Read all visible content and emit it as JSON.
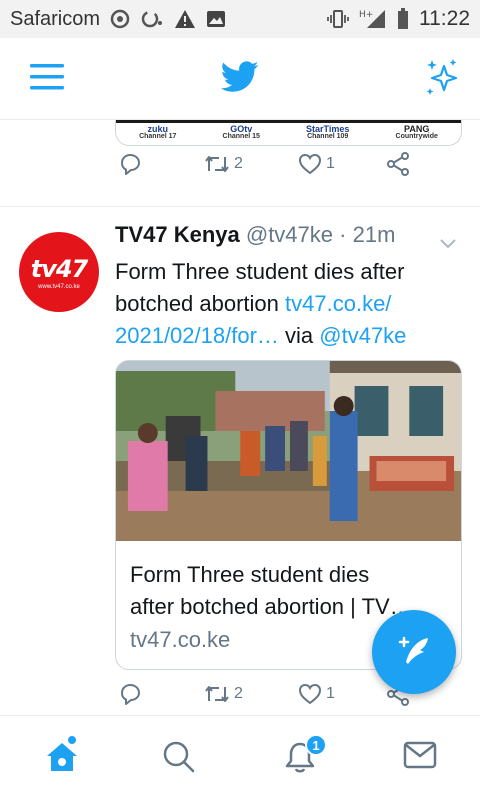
{
  "status_bar": {
    "carrier": "Safaricom",
    "network": "H+",
    "time": "11:22"
  },
  "top_nav": {
    "icons": [
      "menu-icon",
      "twitter-bird-icon",
      "sparkle-icon"
    ]
  },
  "previous_tweet": {
    "channels": [
      {
        "logo": "zuku",
        "label": "Channel 17"
      },
      {
        "logo": "GOtv",
        "label": "Channel 15"
      },
      {
        "logo": "StarTimes",
        "label": "Channel 109"
      },
      {
        "logo": "PANG",
        "label": "Countrywide"
      }
    ],
    "retweet_count": "2",
    "like_count": "1"
  },
  "tweet": {
    "avatar_text": "tv47",
    "avatar_url": "www.tv47.co.ke",
    "name": "TV47 Kenya",
    "handle": "@tv47ke",
    "dot": "·",
    "time": "21m",
    "body_text": "Form Three student dies after botched abortion ",
    "body_link": "tv47.co.ke/​2021/02/18/for…",
    "body_via": " via ",
    "body_mention": "@tv47ke",
    "card": {
      "title": "Form Three student dies after botched abortion | TV…",
      "title_line1": "Form Three student dies",
      "title_line2": "after botched abortion | TV…",
      "domain": "tv47.co.ke"
    },
    "retweet_count": "2",
    "like_count": "1"
  },
  "bottom_nav": {
    "notification_count": "1"
  },
  "colors": {
    "accent": "#1da1f2",
    "text": "#14171a",
    "muted": "#657786",
    "avatar_red": "#e3151a"
  }
}
